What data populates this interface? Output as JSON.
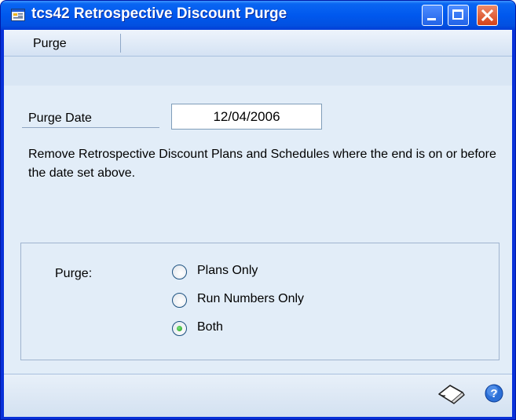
{
  "window": {
    "title": "tcs42 Retrospective Discount Purge",
    "controls": {
      "minimize": "minimize-icon",
      "maximize": "maximize-icon",
      "close": "close-icon"
    }
  },
  "menu": {
    "items": [
      "Purge"
    ]
  },
  "form": {
    "purge_date_label": "Purge Date",
    "purge_date_value": "12/04/2006",
    "description": "Remove Retrospective Discount Plans and Schedules where the end is on or before the date set above.",
    "purge_group_label": "Purge:",
    "options": [
      {
        "label": "Plans Only",
        "selected": false
      },
      {
        "label": "Run Numbers Only",
        "selected": false
      },
      {
        "label": "Both",
        "selected": true
      }
    ]
  },
  "statusbar": {
    "icons": [
      "note-icon",
      "help-icon"
    ]
  },
  "colors": {
    "titlebar": "#0058ee",
    "client": "#d9e6f4",
    "close_button": "#d44218"
  }
}
